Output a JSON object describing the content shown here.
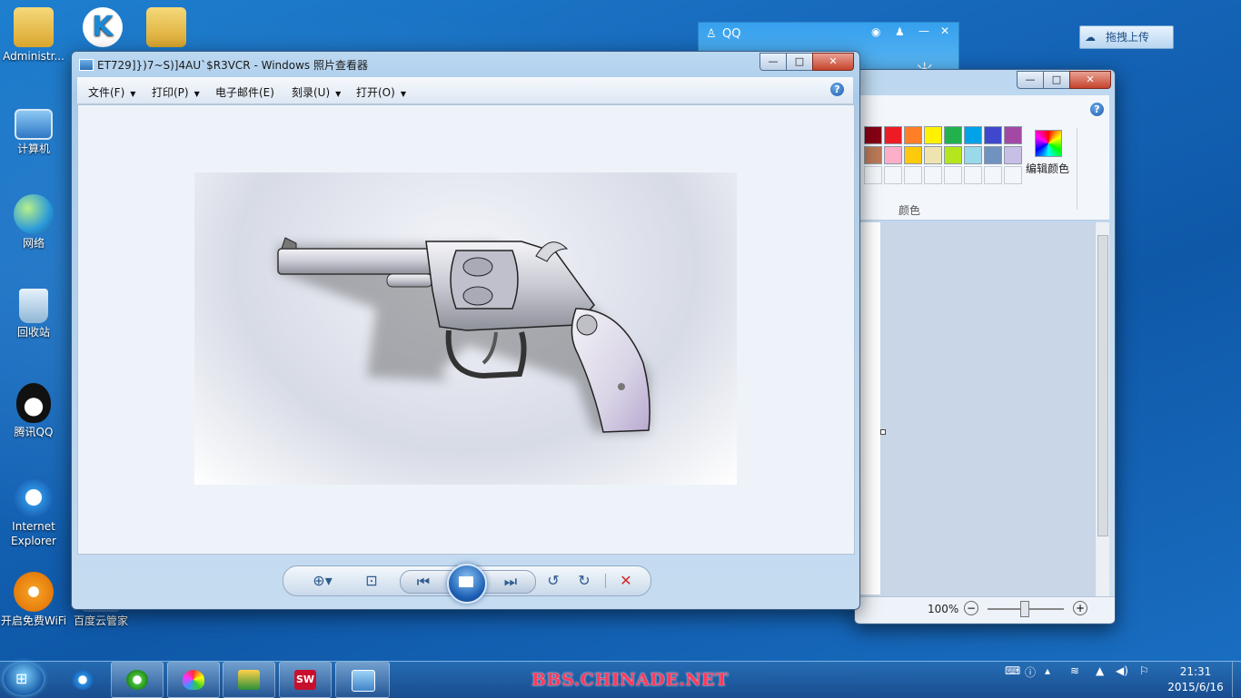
{
  "desktop": {
    "icons": [
      {
        "label": "Administr..."
      },
      {
        "label": "计算机"
      },
      {
        "label": "网络"
      },
      {
        "label": "回收站"
      },
      {
        "label": "腾讯QQ"
      },
      {
        "label": "Internet Explorer"
      },
      {
        "label": "开启免费WiFi"
      },
      {
        "label": "百度云管家"
      }
    ]
  },
  "photo_viewer": {
    "title": "ET729]})7~S)]4AU`$R3VCR - Windows 照片查看器",
    "menus": [
      {
        "label": "文件(F)"
      },
      {
        "label": "打印(P)"
      },
      {
        "label": "电子邮件(E)"
      },
      {
        "label": "刻录(U)"
      },
      {
        "label": "打开(O)"
      }
    ],
    "help_glyph": "?"
  },
  "paint": {
    "edit_colors_label": "编辑颜色",
    "colors_group_label": "颜色",
    "zoom_label": "100%",
    "swatch_colors_row1": [
      "#880015",
      "#ed1c24",
      "#ff7f27",
      "#fff200",
      "#22b14c",
      "#00a2e8",
      "#3f48cc",
      "#a349a4"
    ],
    "swatch_colors_row2": [
      "#b97a57",
      "#ffaec9",
      "#ffc90e",
      "#efe4b0",
      "#b5e61d",
      "#99d9ea",
      "#7092be",
      "#c8bfe7"
    ]
  },
  "qq": {
    "title": "QQ"
  },
  "upload_button": {
    "label": "拖拽上传"
  },
  "taskbar": {
    "watermark": "BBS.CHINADE.NET",
    "time": "21:31",
    "date": "2015/6/16"
  }
}
